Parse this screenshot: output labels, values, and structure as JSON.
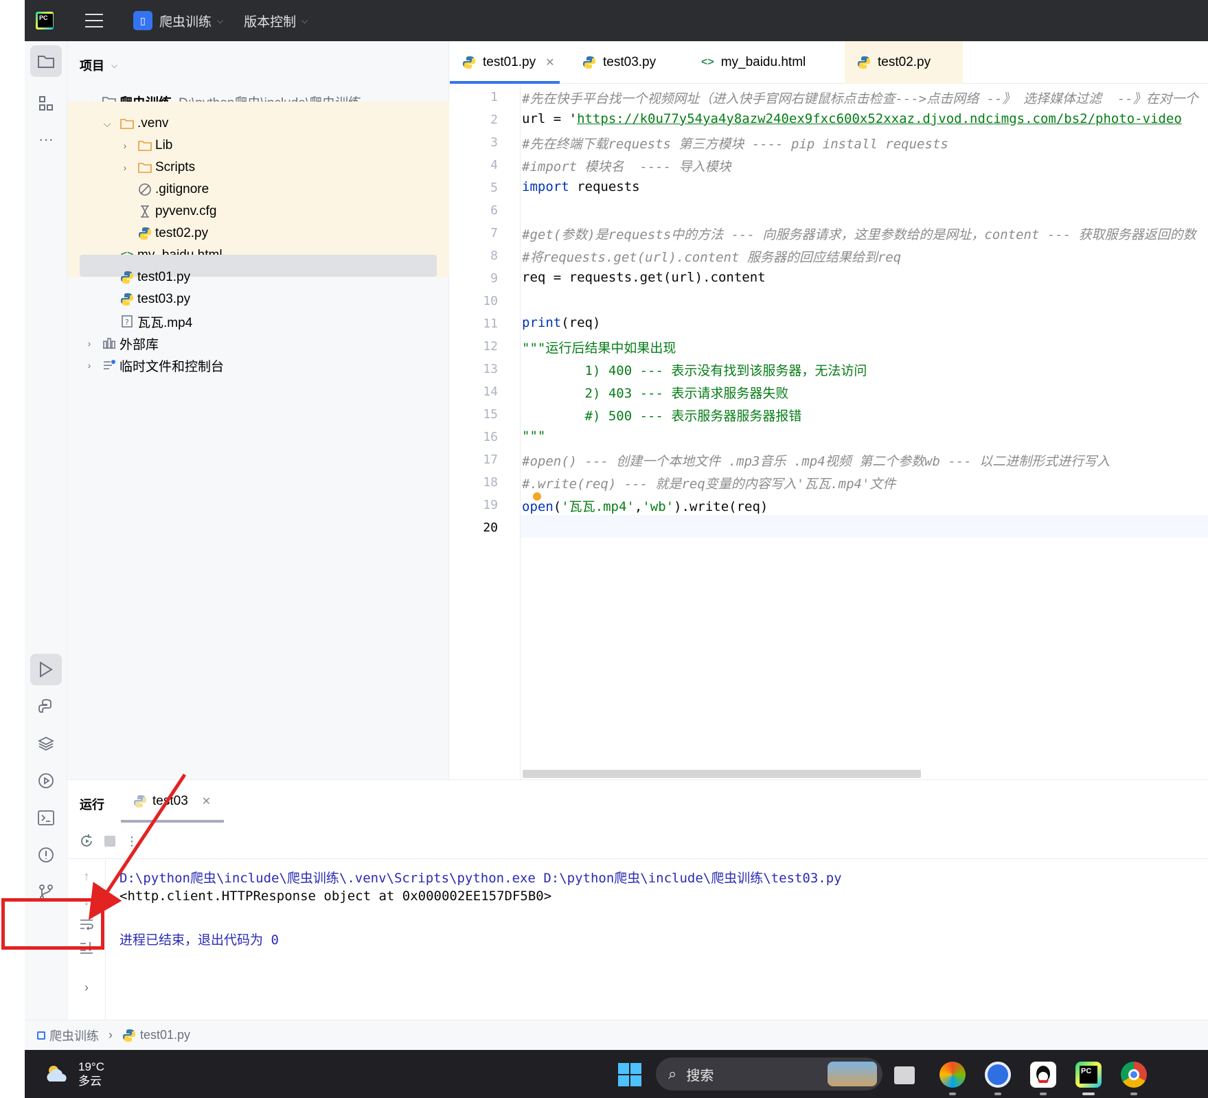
{
  "titlebar": {
    "project_name": "爬虫训练",
    "vcs_menu": "版本控制"
  },
  "project_panel": {
    "title": "项目",
    "items": [
      {
        "label": "爬虫训练",
        "path": "D:\\python爬虫\\include\\爬虫训练",
        "icon": "folder-icon"
      },
      {
        "label": ".venv",
        "icon": "folder-icon"
      },
      {
        "label": "Lib",
        "icon": "folder-icon"
      },
      {
        "label": "Scripts",
        "icon": "folder-icon"
      },
      {
        "label": ".gitignore",
        "icon": "ignore-file-icon"
      },
      {
        "label": "pyvenv.cfg",
        "icon": "config-file-icon"
      },
      {
        "label": "test02.py",
        "icon": "python-icon"
      },
      {
        "label": "my_baidu.html",
        "icon": "html-icon"
      },
      {
        "label": "test01.py",
        "icon": "python-icon"
      },
      {
        "label": "test03.py",
        "icon": "python-icon"
      },
      {
        "label": "瓦瓦.mp4",
        "icon": "unknown-file-icon"
      },
      {
        "label": "外部库",
        "icon": "library-icon"
      },
      {
        "label": "临时文件和控制台",
        "icon": "scratch-icon"
      }
    ]
  },
  "editor": {
    "tabs": [
      {
        "label": "test01.py",
        "icon": "python-icon",
        "active": true
      },
      {
        "label": "test03.py",
        "icon": "python-icon"
      },
      {
        "label": "my_baidu.html",
        "icon": "html-icon"
      },
      {
        "label": "test02.py",
        "icon": "python-icon"
      }
    ],
    "line_numbers": [
      "1",
      "2",
      "3",
      "4",
      "5",
      "6",
      "7",
      "8",
      "9",
      "10",
      "11",
      "12",
      "13",
      "14",
      "15",
      "16",
      "17",
      "18",
      "19",
      "20"
    ],
    "lines": {
      "l1": "#先在快手平台找一个视频网址（进入快手官网右键鼠标点击检查--->点击网络 --》 选择媒体过滤  --》在对一个",
      "l2_pre": "url = '",
      "l2_url": "https://k0u77y54ya4y8azw240ex9fxc600x52xxaz.djvod.ndcimgs.com/bs2/photo-video",
      "l3": "#先在终端下载requests 第三方模块 ---- pip install requests",
      "l4": "#import 模块名  ---- 导入模块",
      "l5_kw": "import",
      "l5_rest": " requests",
      "l7": "#get(参数)是requests中的方法 --- 向服务器请求，这里参数给的是网址，content --- 获取服务器返回的数",
      "l8": "#将requests.get(url).content 服务器的回应结果给到req",
      "l9": "req = requests.get(url).content",
      "l11_fn": "print",
      "l11_rest": "(req)",
      "l12": "\"\"\"运行后结果中如果出现",
      "l13_a": "        1) ",
      "l13_num": "400",
      "l13_b": " --- 表示没有找到该服务器，无法访问",
      "l14_a": "        2) ",
      "l14_num": "403",
      "l14_b": " --- 表示请求服务器失败",
      "l15_a": "        #) ",
      "l15_num": "500",
      "l15_b": " --- 表示服务器服务器报错",
      "l16": "\"\"\"",
      "l17": "#open() --- 创建一个本地文件 .mp3音乐 .mp4视频 第二个参数wb --- 以二进制形式进行写入",
      "l18": "#.write(req) --- 就是req变量的内容写入'瓦瓦.mp4'文件",
      "l19_fn": "open",
      "l19_p1": "(",
      "l19_s1": "'瓦瓦.mp4'",
      "l19_comma": ",",
      "l19_s2": "'wb'",
      "l19_rest": ").write(req)"
    }
  },
  "run_panel": {
    "title": "运行",
    "tab_label": "test03",
    "console": {
      "command": "D:\\python爬虫\\include\\爬虫训练\\.venv\\Scripts\\python.exe D:\\python爬虫\\include\\爬虫训练\\test03.py",
      "output": "<http.client.HTTPResponse object at 0x000002EE157DF5B0>",
      "exit": "进程已结束，退出代码为 0"
    }
  },
  "statusbar": {
    "crumb_project": "爬虫训练",
    "crumb_file": "test01.py"
  },
  "taskbar": {
    "temperature": "19°C",
    "weather": "多云",
    "search_placeholder": "搜索"
  },
  "colors": {
    "accent": "#3574f0",
    "annotation": "#e32222",
    "highlight_row": "#fdf5e3"
  }
}
